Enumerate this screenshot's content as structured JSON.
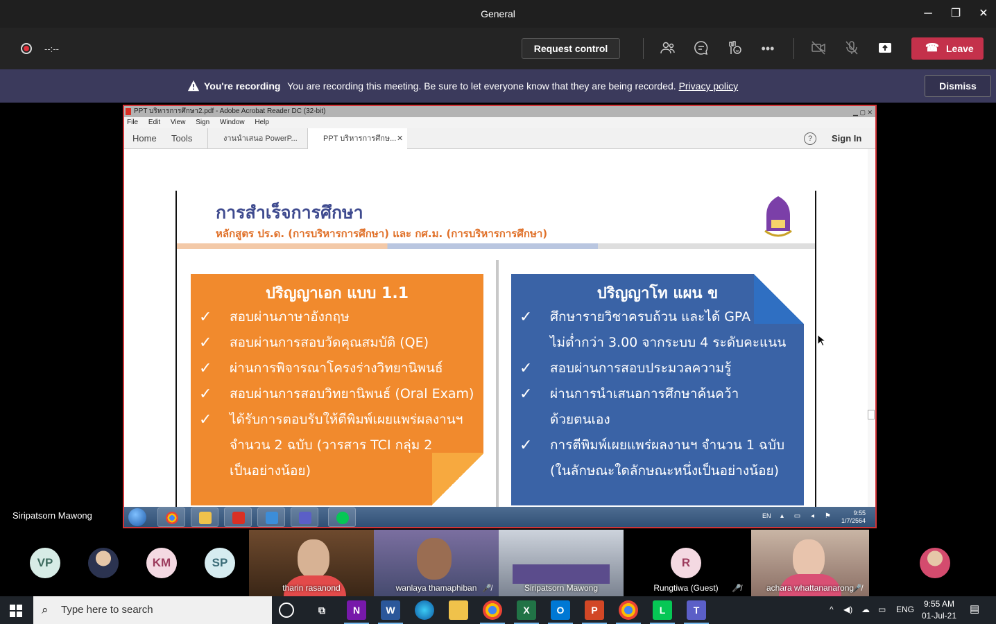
{
  "window": {
    "title": "General",
    "minimize": "─",
    "maximize": "❐",
    "close": "✕"
  },
  "toolbar": {
    "timer": "--:--",
    "request_control": "Request control",
    "leave": "Leave",
    "icons": [
      "people-icon",
      "chat-icon",
      "reactions-icon",
      "more-icon",
      "camera-off-icon",
      "mic-off-icon",
      "share-tray-icon"
    ]
  },
  "banner": {
    "bold": "You're recording",
    "message": "You are recording this meeting. Be sure to let everyone know that they are being recorded.",
    "link": "Privacy policy",
    "dismiss": "Dismiss"
  },
  "presenter": "Siripatsorn Mawong",
  "acrobat": {
    "title": "PPT บริหารการศึกษา2.pdf - Adobe Acrobat Reader DC (32-bit)",
    "menu": [
      "File",
      "Edit",
      "View",
      "Sign",
      "Window",
      "Help"
    ],
    "tabs": [
      "Home",
      "Tools"
    ],
    "doc_tabs": [
      "งานนำเสนอ PowerP...",
      "PPT บริหารการศึกษ..."
    ],
    "help": "?",
    "sign_in": "Sign In"
  },
  "slide": {
    "title": "การสำเร็จการศึกษา",
    "subtitle": "หลักสูตร ปร.ด. (การบริหารการศึกษา) และ กศ.ม. (การบริหารการศึกษา)",
    "left": {
      "heading": "ปริญญาเอก  แบบ 1.1",
      "items": [
        {
          "check": "✓",
          "text": "สอบผ่านภาษาอังกฤษ"
        },
        {
          "check": "✓",
          "text": "สอบผ่านการสอบวัดคุณสมบัติ (QE)"
        },
        {
          "check": "✓",
          "text": "ผ่านการพิจารณาโครงร่างวิทยานิพนธ์"
        },
        {
          "check": "✓",
          "text": "สอบผ่านการสอบวิทยานิพนธ์ (Oral Exam)"
        },
        {
          "check": "✓",
          "text": "ได้รับการตอบรับให้ตีพิมพ์เผยแพร่ผลงานฯ"
        },
        {
          "check": "",
          "text": "จำนวน 2 ฉบับ (วารสาร TCI กลุ่ม 2"
        },
        {
          "check": "",
          "text": "เป็นอย่างน้อย)"
        }
      ]
    },
    "right": {
      "heading": "ปริญญาโท แผน ข",
      "items": [
        {
          "check": "✓",
          "text": "ศึกษารายวิชาครบถ้วน และได้ GPA"
        },
        {
          "check": "",
          "text": "ไม่ต่ำกว่า 3.00 จากระบบ 4 ระดับคะแนน"
        },
        {
          "check": "✓",
          "text": "สอบผ่านการสอบประมวลความรู้"
        },
        {
          "check": "✓",
          "text": "ผ่านการนำเสนอการศึกษาค้นคว้า"
        },
        {
          "check": "",
          "text": "ด้วยตนเอง"
        },
        {
          "check": "✓",
          "text": "การตีพิมพ์เผยแพร่ผลงานฯ จำนวน 1 ฉบับ"
        },
        {
          "check": "",
          "text": "(ในลักษณะใดลักษณะหนึ่งเป็นอย่างน้อย)"
        }
      ]
    }
  },
  "win7": {
    "lang": "EN",
    "time": "9:55",
    "date": "1/7/2564"
  },
  "participants": {
    "avatars": [
      "VP",
      "KM",
      "SP",
      "R"
    ],
    "tiles": [
      "tharin rasanond",
      "wanlaya thamaphiban",
      "Siripatsorn Mawong",
      "Rungtiwa (Guest)",
      "achara whattananarong"
    ]
  },
  "taskbar": {
    "search_placeholder": "Type here to search",
    "lang": "ENG",
    "time": "9:55 AM",
    "date": "01-Jul-21"
  },
  "colors": {
    "leave": "#c4314b",
    "banner": "#3b3a5c",
    "share_border": "#d13438",
    "slide_orange": "#f18a2d",
    "slide_blue": "#3a63a6"
  }
}
